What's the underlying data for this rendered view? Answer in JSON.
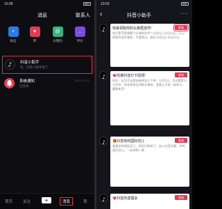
{
  "left": {
    "status_time": "10:08",
    "title": "消息",
    "contacts": "联系人",
    "quick_items": [
      {
        "label": "粉丝",
        "icon": "user-plus-icon",
        "color": "#2a7de1",
        "glyph": "+"
      },
      {
        "label": "赞",
        "icon": "heart-icon",
        "color": "#e23c55",
        "glyph": "♥"
      },
      {
        "label": "@我的",
        "icon": "at-icon",
        "color": "#36b37e",
        "glyph": "@"
      },
      {
        "label": "评论",
        "icon": "comment-icon",
        "color": "#7c4ddb",
        "glyph": "…"
      }
    ],
    "messages": [
      {
        "name": "抖音小助手",
        "sub": "哇，抖音小助手来了",
        "date": "",
        "avatar_color": "#111"
      },
      {
        "name": "系统通知",
        "sub": "已登录",
        "date": "2019-10-24",
        "avatar_color": "#e23c55"
      }
    ],
    "nav": [
      {
        "label": "首页"
      },
      {
        "label": "关注"
      },
      {
        "label": "消息"
      },
      {
        "label": "我"
      }
    ]
  },
  "right": {
    "status_time": "10:03",
    "title": "抖音小助手",
    "cards": [
      {
        "title": "快来领取你的头像框挂件!",
        "text": "你们是不是想要个头像框挂件? 11月1日-11月11日，可以获取抖音好看框，不要错过。截至11月1日-11月11日",
        "button": "参加"
      },
      {
        "title": "💗花瓣抖音打卡招领!",
        "text": "你好，这次活动要由新朋友小个单，11月1日，活动要是与小伙伴，快来直接去领取头像框，我要让大家一起参与，赢取新奖！",
        "button": "参加"
      },
      {
        "title": "🎁抖音你的国际范儿",
        "text": "看看你的国际范儿，同学们都来了，加入抖音好看，你的国际范儿，一起来晒一晒",
        "button": "参加"
      },
      {
        "title": "💗抖音的送福会",
        "text": "",
        "button": "参加"
      }
    ]
  }
}
